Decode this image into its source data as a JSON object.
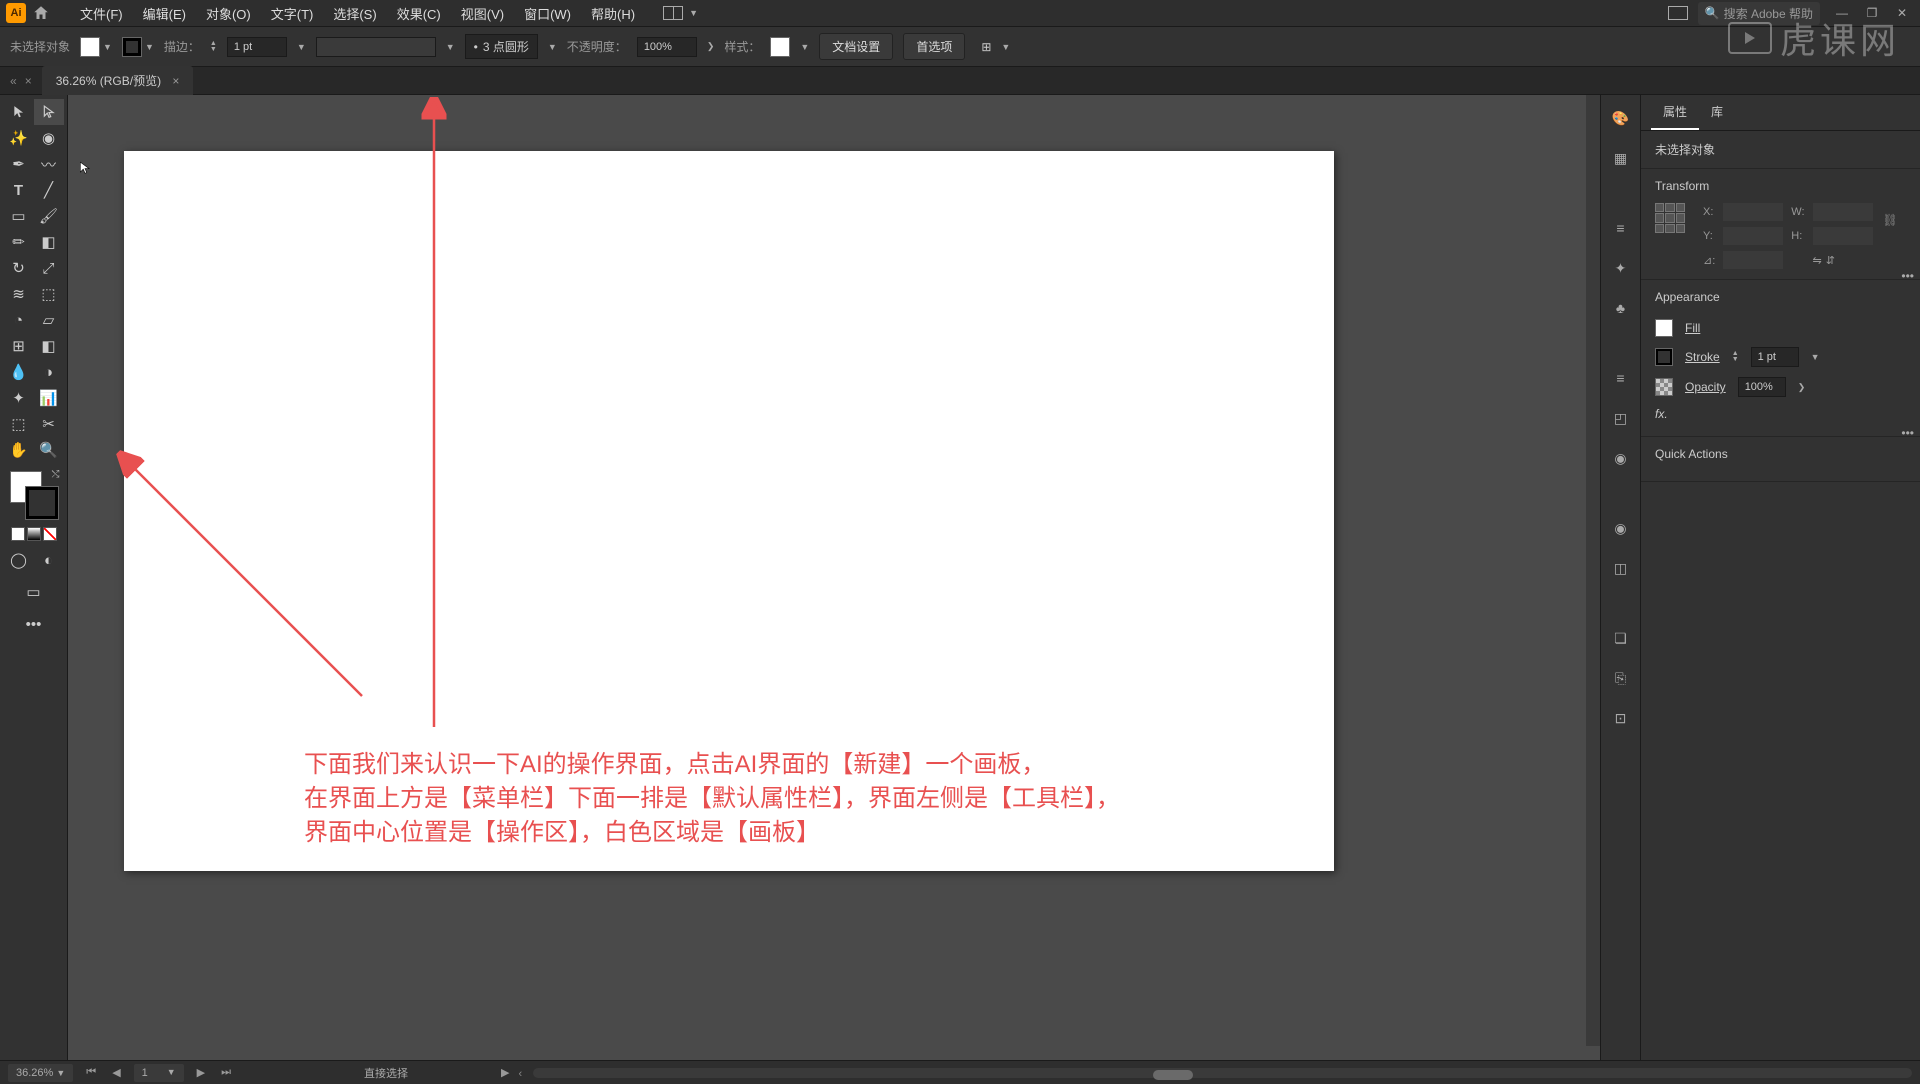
{
  "menubar": {
    "items": [
      "文件(F)",
      "编辑(E)",
      "对象(O)",
      "文字(T)",
      "选择(S)",
      "效果(C)",
      "视图(V)",
      "窗口(W)",
      "帮助(H)"
    ],
    "search_placeholder": "搜索 Adobe 帮助"
  },
  "control": {
    "no_selection": "未选择对象",
    "stroke_label": "描边：",
    "stroke_value": "1 pt",
    "shape_label": "3 点圆形",
    "opacity_label": "不透明度：",
    "opacity_value": "100%",
    "style_label": "样式：",
    "doc_setup": "文档设置",
    "prefs": "首选项"
  },
  "doc_tab": {
    "title": "36.26% (RGB/预览)"
  },
  "annotation": {
    "line1": "下面我们来认识一下AI的操作界面，点击AI界面的【新建】一个画板，",
    "line2": "在界面上方是【菜单栏】下面一排是【默认属性栏】，界面左侧是【工具栏】，",
    "line3": "界面中心位置是【操作区】，白色区域是【画板】"
  },
  "right_panel": {
    "tabs": [
      "属性",
      "库"
    ],
    "no_selection": "未选择对象",
    "transform_title": "Transform",
    "transform": {
      "x": "",
      "y": "",
      "w": "",
      "h": "",
      "rotate": ""
    },
    "appearance_title": "Appearance",
    "fill_label": "Fill",
    "stroke_label": "Stroke",
    "stroke_value": "1 pt",
    "opacity_label": "Opacity",
    "opacity_value": "100%",
    "fx_label": "fx.",
    "quick_actions": "Quick Actions"
  },
  "statusbar": {
    "zoom": "36.26%",
    "artboard": "1",
    "tool_hint": "直接选择"
  },
  "watermark": "虎课网"
}
